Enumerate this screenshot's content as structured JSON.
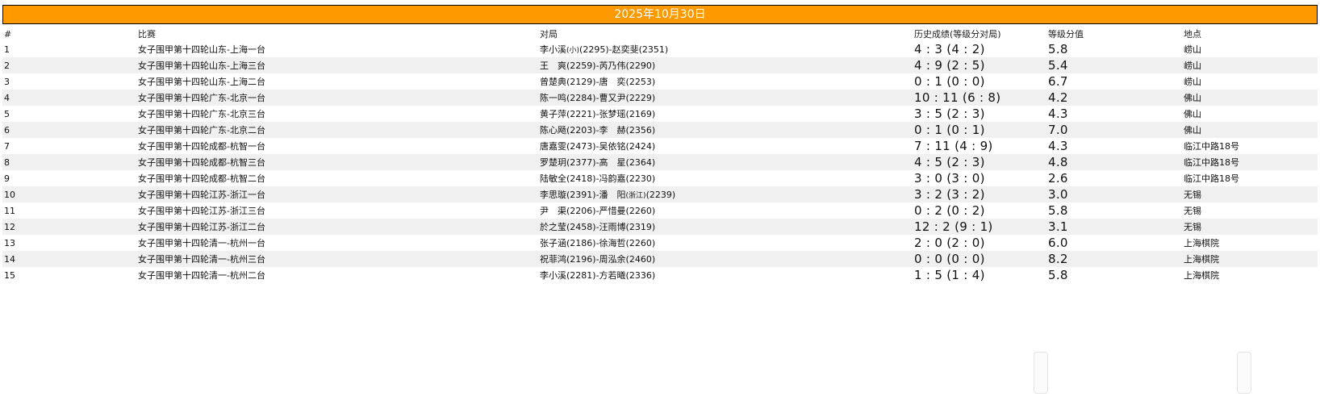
{
  "banner": {
    "date": "2025年10月30日"
  },
  "headers": {
    "num": "#",
    "competition": "比赛",
    "pairing": "对局",
    "history": "历史成绩(等级分对局)",
    "rating": "等级分值",
    "location": "地点"
  },
  "rows": [
    {
      "num": "1",
      "competition": "女子围甲第十四轮山东-上海一台",
      "p1": "李小溪",
      "p1_tag": "(小)",
      "p1_rest": "(2295)-赵奕斐(2351)",
      "history": "4 : 3 (4 : 2)",
      "rating": "5.8",
      "location": "崂山"
    },
    {
      "num": "2",
      "competition": "女子围甲第十四轮山东-上海三台",
      "p1": "王　爽(2259)-芮乃伟(2290)",
      "p1_tag": "",
      "p1_rest": "",
      "history": "4 : 9 (2 : 5)",
      "rating": "5.4",
      "location": "崂山"
    },
    {
      "num": "3",
      "competition": "女子围甲第十四轮山东-上海二台",
      "p1": "曾楚典(2129)-唐　奕(2253)",
      "p1_tag": "",
      "p1_rest": "",
      "history": "0 : 1 (0 : 0)",
      "rating": "6.7",
      "location": "崂山"
    },
    {
      "num": "4",
      "competition": "女子围甲第十四轮广东-北京一台",
      "p1": "陈一鸣(2284)-曹又尹(2229)",
      "p1_tag": "",
      "p1_rest": "",
      "history": "10 : 11 (6 : 8)",
      "rating": "4.2",
      "location": "佛山"
    },
    {
      "num": "5",
      "competition": "女子围甲第十四轮广东-北京三台",
      "p1": "黄子萍(2221)-张梦瑶(2169)",
      "p1_tag": "",
      "p1_rest": "",
      "history": "3 : 5 (2 : 3)",
      "rating": "4.3",
      "location": "佛山"
    },
    {
      "num": "6",
      "competition": "女子围甲第十四轮广东-北京二台",
      "p1": "陈心飏(2203)-李　赫(2356)",
      "p1_tag": "",
      "p1_rest": "",
      "history": "0 : 1 (0 : 1)",
      "rating": "7.0",
      "location": "佛山"
    },
    {
      "num": "7",
      "competition": "女子围甲第十四轮成都-杭智一台",
      "p1": "唐嘉雯(2473)-吴依铭(2424)",
      "p1_tag": "",
      "p1_rest": "",
      "history": "7 : 11 (4 : 9)",
      "rating": "4.3",
      "location": "临江中路18号"
    },
    {
      "num": "8",
      "competition": "女子围甲第十四轮成都-杭智三台",
      "p1": "罗楚玥(2377)-高　星(2364)",
      "p1_tag": "",
      "p1_rest": "",
      "history": "4 : 5 (2 : 3)",
      "rating": "4.8",
      "location": "临江中路18号"
    },
    {
      "num": "9",
      "competition": "女子围甲第十四轮成都-杭智二台",
      "p1": "陆敏全(2418)-冯韵嘉(2230)",
      "p1_tag": "",
      "p1_rest": "",
      "history": "3 : 0 (3 : 0)",
      "rating": "2.6",
      "location": "临江中路18号"
    },
    {
      "num": "10",
      "competition": "女子围甲第十四轮江苏-浙江一台",
      "p1": "李思璇(2391)-潘　阳",
      "p1_tag": "(浙江)",
      "p1_rest": "(2239)",
      "history": "3 : 2 (3 : 2)",
      "rating": "3.0",
      "location": "无锡"
    },
    {
      "num": "11",
      "competition": "女子围甲第十四轮江苏-浙江三台",
      "p1": "尹　渠(2206)-严惜曼(2260)",
      "p1_tag": "",
      "p1_rest": "",
      "history": "0 : 2 (0 : 2)",
      "rating": "5.8",
      "location": "无锡"
    },
    {
      "num": "12",
      "competition": "女子围甲第十四轮江苏-浙江二台",
      "p1": "於之莹(2458)-汪雨博(2319)",
      "p1_tag": "",
      "p1_rest": "",
      "history": "12 : 2 (9 : 1)",
      "rating": "3.1",
      "location": "无锡"
    },
    {
      "num": "13",
      "competition": "女子围甲第十四轮清一-杭州一台",
      "p1": "张子涵(2186)-徐海哲(2260)",
      "p1_tag": "",
      "p1_rest": "",
      "history": "2 : 0 (2 : 0)",
      "rating": "6.0",
      "location": "上海棋院"
    },
    {
      "num": "14",
      "competition": "女子围甲第十四轮清一-杭州三台",
      "p1": "祝菲鸿(2196)-周泓余(2460)",
      "p1_tag": "",
      "p1_rest": "",
      "history": "0 : 0 (0 : 0)",
      "rating": "8.2",
      "location": "上海棋院"
    },
    {
      "num": "15",
      "competition": "女子围甲第十四轮清一-杭州二台",
      "p1": "李小溪(2281)-方若曦(2336)",
      "p1_tag": "",
      "p1_rest": "",
      "history": "1 : 5 (1 : 4)",
      "rating": "5.8",
      "location": "上海棋院"
    }
  ]
}
